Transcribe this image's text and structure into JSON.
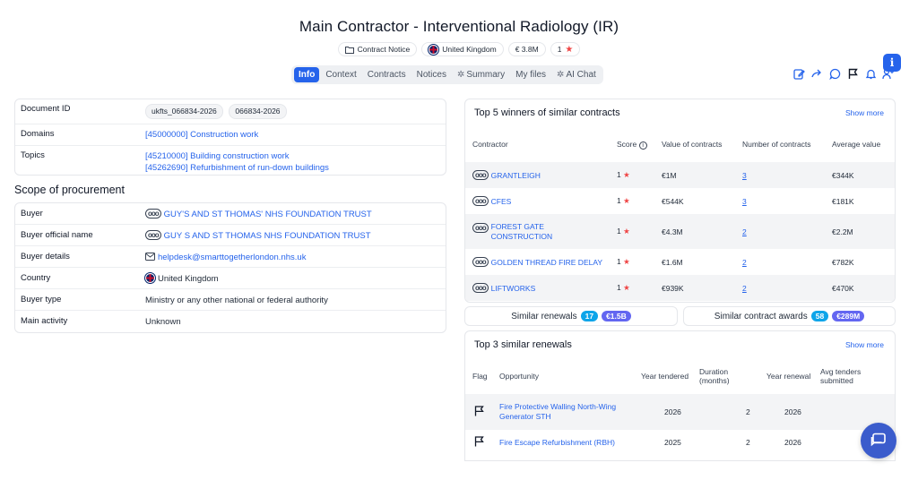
{
  "page": {
    "title": "Main Contractor - Interventional Radiology (IR)",
    "meta": {
      "notice_type": "Contract Notice",
      "country": "United Kingdom",
      "value": "€ 3.8M",
      "score": "1"
    }
  },
  "tabs": [
    {
      "label": "Info",
      "active": true
    },
    {
      "label": "Context"
    },
    {
      "label": "Contracts"
    },
    {
      "label": "Notices"
    },
    {
      "label": "Summary",
      "icon": "sparkle-icon"
    },
    {
      "label": "My files"
    },
    {
      "label": "AI Chat",
      "icon": "sparkle-icon"
    }
  ],
  "toolbar": {
    "icons": [
      "edit-icon",
      "share-icon",
      "comment-icon",
      "flag-icon",
      "bell-icon",
      "add-user-icon"
    ],
    "info_label": "i"
  },
  "document": {
    "id_label": "Document ID",
    "id_tags": [
      "ukfts_066834-2026",
      "066834-2026"
    ],
    "domains_label": "Domains",
    "domains": [
      "[45000000] Construction work"
    ],
    "topics_label": "Topics",
    "topics": [
      "[45210000] Building construction work",
      "[45262690] Refurbishment of run-down buildings"
    ]
  },
  "scope": {
    "title": "Scope of procurement",
    "rows": [
      {
        "key": "Buyer",
        "value": "GUY'S AND ST THOMAS' NHS FOUNDATION TRUST",
        "link": true,
        "icon": "org"
      },
      {
        "key": "Buyer official name",
        "value": "GUY S AND ST THOMAS NHS FOUNDATION TRUST",
        "link": true,
        "icon": "org"
      },
      {
        "key": "Buyer details",
        "value": "helpdesk@smarttogetherlondon.nhs.uk",
        "link": true,
        "icon": "mail"
      },
      {
        "key": "Country",
        "value": "United Kingdom",
        "link": false,
        "icon": "flag"
      },
      {
        "key": "Buyer type",
        "value": "Ministry or any other national or federal authority",
        "link": false
      },
      {
        "key": "Main activity",
        "value": "Unknown",
        "link": false
      }
    ]
  },
  "winners": {
    "title": "Top 5 winners of similar contracts",
    "show_more": "Show more",
    "headers": {
      "contractor": "Contractor",
      "score": "Score",
      "value": "Value of contracts",
      "number": "Number of contracts",
      "average": "Average value"
    },
    "rows": [
      {
        "name": "GRANTLEIGH",
        "score": "1",
        "value": "€1M",
        "number": "3",
        "average": "€344K"
      },
      {
        "name": "CFES",
        "score": "1",
        "value": "€544K",
        "number": "3",
        "average": "€181K"
      },
      {
        "name": "FOREST GATE CONSTRUCTION",
        "score": "1",
        "value": "€4.3M",
        "number": "2",
        "average": "€2.2M"
      },
      {
        "name": "GOLDEN THREAD FIRE DELAY",
        "score": "1",
        "value": "€1.6M",
        "number": "2",
        "average": "€782K"
      },
      {
        "name": "LIFTWORKS",
        "score": "1",
        "value": "€939K",
        "number": "2",
        "average": "€470K"
      }
    ]
  },
  "similar": {
    "renewals_label": "Similar renewals",
    "renewals_count": "17",
    "renewals_value": "€1.5B",
    "awards_label": "Similar contract awards",
    "awards_count": "58",
    "awards_value": "€289M"
  },
  "renewals": {
    "title": "Top 3 similar renewals",
    "show_more": "Show more",
    "headers": {
      "flag": "Flag",
      "opportunity": "Opportunity",
      "year_tendered": "Year tendered",
      "duration": "Duration (months)",
      "year_renewal": "Year renewal",
      "avg_tenders": "Avg tenders submitted"
    },
    "rows": [
      {
        "opportunity": "Fire Protective Walling North-Wing Generator STH",
        "year_tendered": "2026",
        "duration": "2",
        "year_renewal": "2026",
        "avg_tenders": ""
      },
      {
        "opportunity": "Fire Escape Refurbishment (RBH)",
        "year_tendered": "2025",
        "duration": "2",
        "year_renewal": "2026",
        "avg_tenders": ""
      }
    ]
  },
  "colors": {
    "accent": "#2563eb",
    "star": "#ef4444",
    "count_badge": "#0ea5e9",
    "value_badge": "#6366f1"
  }
}
